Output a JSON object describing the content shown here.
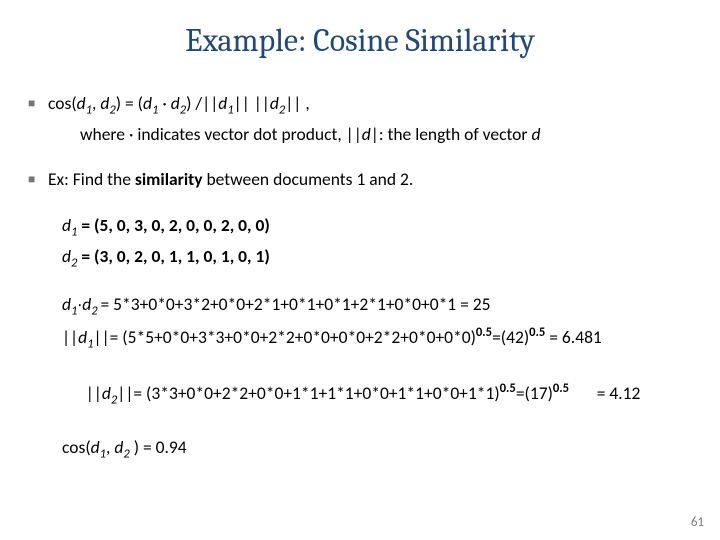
{
  "title": "Example: Cosine Similarity",
  "line1_a": "cos(",
  "line1_d1": "d",
  "line1_d1s": "1",
  "line1_comma": ", ",
  "line1_d2": "d",
  "line1_d2s": "2",
  "line1_b": ") =  (",
  "line1_d3": "d",
  "line1_d3s": "1",
  "line1_dot": " · ",
  "line1_d4": "d",
  "line1_d4s": "2",
  "line1_c": ") /||",
  "line1_d5": "d",
  "line1_d5s": "1",
  "line1_d": "|| ||",
  "line1_d6": "d",
  "line1_d6s": "2",
  "line1_e": "|| ,",
  "line2_a": "where · indicates vector dot product, ||",
  "line2_d": "d",
  "line2_b": "|: the length of vector ",
  "line2_d2": "d",
  "line3_a": "Ex: Find the ",
  "line3_b": "similarity",
  "line3_c": " between documents 1 and 2.",
  "line4_d": "d",
  "line4_s": "1",
  "line4_rest": " =  (5, 0, 3, 0, 2, 0, 0, 2, 0, 0)",
  "line5_d": "d",
  "line5_s": "2",
  "line5_rest": " =  (3, 0, 2, 0, 1, 1, 0, 1, 0, 1)",
  "line6_d1": "d",
  "line6_s1": "1",
  "line6_dot": "∙",
  "line6_d2": "d",
  "line6_s2": "2 ",
  "line6_rest": "= 5*3+0*0+3*2+0*0+2*1+0*1+0*1+2*1+0*0+0*1 = 25",
  "line7_a": "||",
  "line7_d": "d",
  "line7_s": "1",
  "line7_b": "||= (5*5+0*0+3*3+0*0+2*2+0*0+0*0+2*2+0*0+0*0)",
  "line7_exp": "0.5",
  "line7_c": "=(42)",
  "line7_exp2": "0.5",
  "line7_d2": "  = 6.481",
  "line8_a": "||",
  "line8_d": "d",
  "line8_s": "2",
  "line8_b": "||= (3*3+0*0+2*2+0*0+1*1+1*1+0*0+1*1+0*0+1*1)",
  "line8_exp": "0.5",
  "line8_c": "=(17)",
  "line8_exp2": "0.5",
  "line8_d2": "       = 4.12",
  "line9_a": "cos(",
  "line9_d1": "d",
  "line9_s1": "1",
  "line9_comma": ", ",
  "line9_d2": "d",
  "line9_s2": "2",
  "line9_rest": " ) = 0.94",
  "pagenum": "61",
  "bullet": "■"
}
